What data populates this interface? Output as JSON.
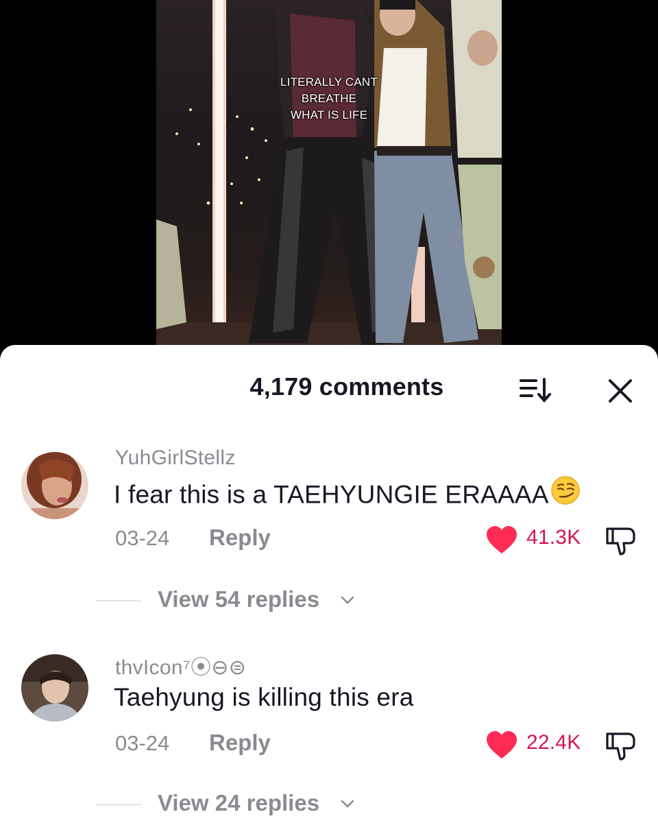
{
  "video": {
    "caption_lines": [
      "LITERALLY CANT",
      "BREATHE",
      "WHAT IS LIFE"
    ]
  },
  "comments_panel": {
    "count_label": "4,179 comments",
    "sort_icon": "sort-icon",
    "close_icon": "close-icon"
  },
  "comments": [
    {
      "username": "YuhGirlStellz",
      "text": "I fear this is a TAEHYUNGIE ERAAAA",
      "emoji": "smirk-emoji",
      "date": "03-24",
      "reply_label": "Reply",
      "likes": "41.3K",
      "view_replies_label": "View 54 replies"
    },
    {
      "username": "thvIcon⁷⦿⊖⊜",
      "text": "Taehyung is killing this era",
      "date": "03-24",
      "reply_label": "Reply",
      "likes": "22.4K",
      "view_replies_label": "View 24 replies"
    }
  ],
  "colors": {
    "like_red": "#fe2c55",
    "like_count": "#d3144c",
    "secondary_text": "#8a8b91",
    "primary_text": "#161823"
  }
}
